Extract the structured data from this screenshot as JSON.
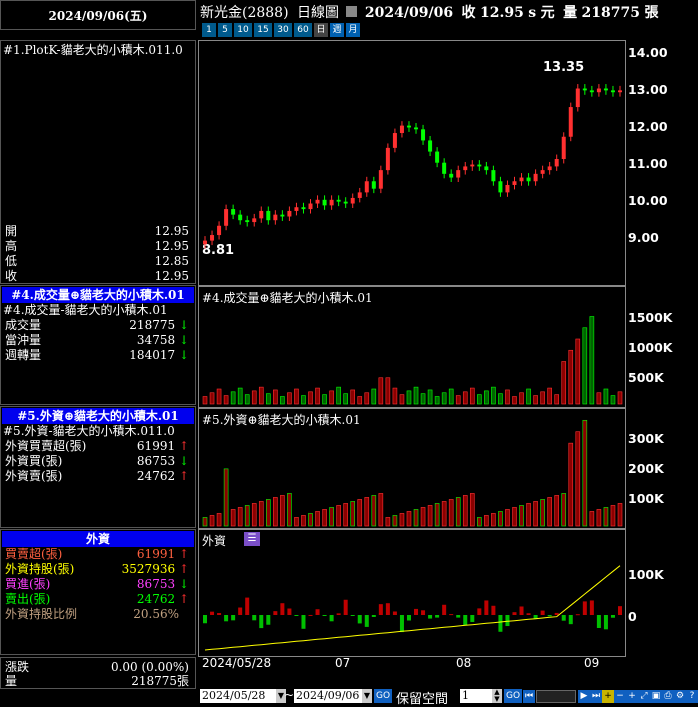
{
  "header": {
    "date_weekday": "2024/09/06(五)",
    "stock": "新光金(2888)",
    "chart_type": "日線圖",
    "quote_date": "2024/09/06",
    "close_label": "收",
    "close_value": "12.95",
    "flag": "s",
    "unit": "元",
    "volume_label": "量",
    "volume_value": "218775",
    "volume_unit": "張"
  },
  "periods": [
    "1",
    "5",
    "10",
    "15",
    "30",
    "60",
    "日",
    "週",
    "月"
  ],
  "panel1": {
    "title": "#1.PlotK-貓老大的小積木.011.0",
    "ohlc": [
      {
        "label": "開",
        "value": "12.95"
      },
      {
        "label": "高",
        "value": "12.95"
      },
      {
        "label": "低",
        "value": "12.85"
      },
      {
        "label": "收",
        "value": "12.95"
      }
    ],
    "annot_high": "13.35",
    "annot_low": "8.81",
    "yticks": [
      "14.00",
      "13.00",
      "12.00",
      "11.00",
      "10.00",
      "9.00"
    ]
  },
  "panel2": {
    "header": "#4.成交量⊕貓老大的小積木.01",
    "subheader": "#4.成交量-貓老大的小積木.01",
    "chart_title": "#4.成交量⊕貓老大的小積木.01",
    "rows": [
      {
        "label": "成交量",
        "value": "218775"
      },
      {
        "label": "當沖量",
        "value": "34758"
      },
      {
        "label": "週轉量",
        "value": "184017"
      }
    ],
    "yticks": [
      "1500K",
      "1000K",
      "500K"
    ]
  },
  "panel3": {
    "header": "#5.外資⊕貓老大的小積木.01",
    "subheader": "#5.外資-貓老大的小積木.011.0",
    "chart_title": "#5.外資⊕貓老大的小積木.01",
    "rows": [
      {
        "label": "外資買賣超(張)",
        "value": "61991"
      },
      {
        "label": "外資買(張)",
        "value": "86753"
      },
      {
        "label": "外資賣(張)",
        "value": "24762"
      }
    ],
    "yticks": [
      "300K",
      "200K",
      "100K"
    ]
  },
  "panel4": {
    "header": "外資",
    "chart_title": "外資",
    "rows": [
      {
        "label": "買賣超(張)",
        "value": "61991"
      },
      {
        "label": "外資持股(張)",
        "value": "3527936"
      },
      {
        "label": "買進(張)",
        "value": "86753"
      },
      {
        "label": "賣出(張)",
        "value": "24762"
      },
      {
        "label": "外資持股比例",
        "value": "20.56%"
      }
    ],
    "yticks": [
      "100K",
      "0"
    ]
  },
  "footer": {
    "change_label": "漲跌",
    "change_value": "0.00 (0.00%)",
    "vol_label": "量",
    "vol_value": "218775張"
  },
  "xaxis": [
    "2024/05/28",
    "07",
    "08",
    "09"
  ],
  "bottombar": {
    "date_from": "2024/05/28",
    "sep": "~",
    "date_to": "2024/09/06",
    "go": "GO",
    "reserve_label": "保留空間",
    "reserve_value": "1",
    "go2": "GO"
  },
  "colors": {
    "up": "#ff3030",
    "down": "#00ff00",
    "blue": "#0000ee",
    "yellow": "#ffff00"
  },
  "chart_data": {
    "type": "candlestick",
    "title": "新光金(2888) 日線圖",
    "x_range": [
      "2024/05/28",
      "2024/09/06"
    ],
    "price_ylim": [
      8.0,
      14.2
    ],
    "max": 13.35,
    "min": 8.81,
    "last_close": 12.95,
    "last_volume": 218775,
    "close_series": [
      8.9,
      9.05,
      9.3,
      9.75,
      9.6,
      9.45,
      9.4,
      9.5,
      9.7,
      9.45,
      9.6,
      9.55,
      9.7,
      9.8,
      9.75,
      9.9,
      10.0,
      9.85,
      10.0,
      9.95,
      9.9,
      10.05,
      10.2,
      10.5,
      10.3,
      10.8,
      11.4,
      11.8,
      12.0,
      11.95,
      11.9,
      11.6,
      11.3,
      11.0,
      10.7,
      10.6,
      10.8,
      10.9,
      10.95,
      10.9,
      10.8,
      10.5,
      10.2,
      10.4,
      10.5,
      10.6,
      10.5,
      10.7,
      10.8,
      10.9,
      11.1,
      11.7,
      12.5,
      13.0,
      12.95,
      12.9,
      13.0,
      12.95,
      12.9,
      12.95
    ]
  }
}
